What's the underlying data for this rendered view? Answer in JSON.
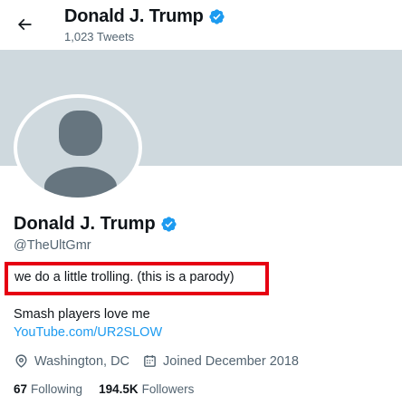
{
  "header": {
    "name": "Donald J. Trump",
    "tweet_count": "1,023 Tweets"
  },
  "profile": {
    "name": "Donald J. Trump",
    "handle": "@TheUltGmr",
    "bio_highlighted": "we do a little trolling. (this is a parody)",
    "bio_line2": "Smash players love me",
    "link": "YouTube.com/UR2SLOW",
    "location": "Washington, DC",
    "joined": "Joined December 2018",
    "following_count": "67",
    "following_label": "Following",
    "followers_count": "194.5K",
    "followers_label": "Followers"
  },
  "colors": {
    "verified_badge": "#1d9bf0",
    "highlight_box": "#e60012",
    "banner": "#cfd9de",
    "link": "#1d9bf0"
  },
  "icons": {
    "back": "arrow-left-icon",
    "verified": "verified-badge-icon",
    "location": "location-pin-icon",
    "calendar": "calendar-icon",
    "avatar": "default-avatar-silhouette"
  }
}
